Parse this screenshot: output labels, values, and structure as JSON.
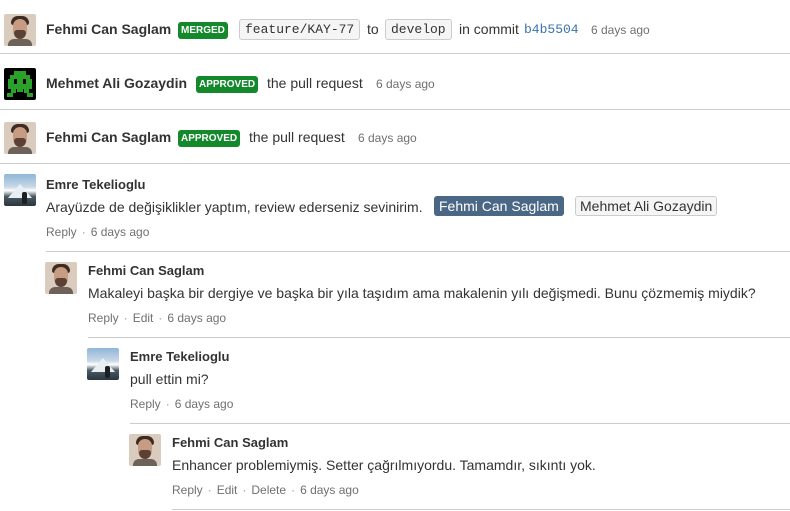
{
  "colors": {
    "approved": "#14892c",
    "link": "#3b73af",
    "mention_active": "#4a6785"
  },
  "activities": [
    {
      "author": "Fehmi Can Saglam",
      "avatar_icon": "bearded-man-avatar",
      "badge": "MERGED",
      "source_branch": "feature/KAY-77",
      "to_text": "to",
      "target_branch": "develop",
      "in_commit_text": "in commit",
      "commit": "b4b5504",
      "time": "6 days ago"
    },
    {
      "author": "Mehmet Ali Gozaydin",
      "avatar_icon": "pixel-invader-avatar",
      "badge": "APPROVED",
      "text": "the pull request",
      "time": "6 days ago"
    },
    {
      "author": "Fehmi Can Saglam",
      "avatar_icon": "bearded-man-avatar",
      "badge": "APPROVED",
      "text": "the pull request",
      "time": "6 days ago"
    }
  ],
  "comments": [
    {
      "author": "Emre Tekelioglu",
      "avatar_icon": "mountain-avatar",
      "text": "Arayüzde de değişiklikler yaptım, review ederseniz sevinirim.",
      "mentions": [
        "Fehmi Can Saglam",
        "Mehmet Ali Gozaydin"
      ],
      "actions": [
        "Reply"
      ],
      "time": "6 days ago"
    },
    {
      "author": "Fehmi Can Saglam",
      "avatar_icon": "bearded-man-avatar",
      "text": "Makaleyi başka bir dergiye ve başka bir yıla taşıdım ama makalenin yılı değişmedi. Bunu çözmemiş miydik?",
      "actions": [
        "Reply",
        "Edit"
      ],
      "time": "6 days ago"
    },
    {
      "author": "Emre Tekelioglu",
      "avatar_icon": "mountain-avatar",
      "text": "pull ettin mi?",
      "actions": [
        "Reply"
      ],
      "time": "6 days ago"
    },
    {
      "author": "Fehmi Can Saglam",
      "avatar_icon": "bearded-man-avatar",
      "text": "Enhancer problemiymiş. Setter çağrılmıyordu. Tamamdır, sıkıntı yok.",
      "actions": [
        "Reply",
        "Edit",
        "Delete"
      ],
      "time": "6 days ago"
    }
  ]
}
